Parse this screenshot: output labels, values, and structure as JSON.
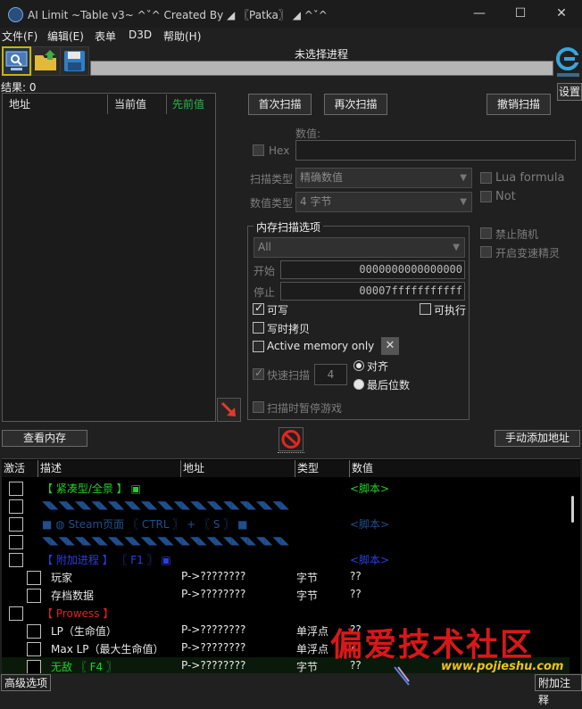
{
  "window": {
    "title": "AI Limit ~Table v3~   ^ˇ^ Created By ◢ 〖Patka〗 ◢ ^ˇ^",
    "controls": {
      "min": "—",
      "max": "☐",
      "close": "✕"
    }
  },
  "menu": [
    "文件(F)",
    "编辑(E)",
    "表单",
    "D3D",
    "帮助(H)"
  ],
  "toolbar": {
    "process_title": "未选择进程",
    "settings": "设置",
    "icons": [
      "open-process-icon",
      "open-file-icon",
      "save-icon"
    ]
  },
  "results": {
    "label": "结果: 0"
  },
  "found_list": {
    "columns": [
      "地址",
      "当前值",
      "先前值"
    ],
    "previous_color": "#2fb54a"
  },
  "scan": {
    "first_scan": "首次扫描",
    "next_scan": "再次扫描",
    "undo_scan": "撤销扫描",
    "value_label": "数值:",
    "hex_label": "Hex",
    "value": "",
    "scan_type_label": "扫描类型",
    "scan_type_value": "精确数值",
    "value_type_label": "数值类型",
    "value_type_value": "4 字节",
    "lua_formula": "Lua formula",
    "not_label": "Not"
  },
  "memory_options": {
    "title": "内存扫描选项",
    "region": "All",
    "start_label": "开始",
    "start_value": "0000000000000000",
    "stop_label": "停止",
    "stop_value": "00007fffffffffff",
    "writable": "可写",
    "executable": "可执行",
    "copy_on_write": "写时拷贝",
    "active_memory_only": "Active memory only",
    "fast_scan": "快速扫描",
    "fast_scan_value": "4",
    "alignment": "对齐",
    "last_digits": "最后位数",
    "pause_game": "扫描时暂停游戏",
    "disable_random": "禁止随机",
    "speedhack": "开启变速精灵"
  },
  "buttons": {
    "view_memory": "查看内存",
    "add_address": "手动添加地址",
    "advanced": "高级选项",
    "table_extras": "附加注释"
  },
  "address_list": {
    "headers": [
      "激活",
      "描述",
      "地址",
      "类型",
      "数值"
    ],
    "rows": [
      {
        "desc": "【 紧凑型/全景 】  ▣",
        "address": "",
        "type": "",
        "value": "<脚本>",
        "color": "#22d022",
        "indent": 0
      },
      {
        "desc": "◥◣◥◣◥◣◥◣◥◣◥◣◥◣◥◣◥◣◥◣◥◣◥◣◥◣◥◣◥◣",
        "address": "",
        "type": "",
        "value": "",
        "color": "#1f4f8f",
        "indent": 0
      },
      {
        "desc": "■  ◍ Steam页面  〖 CTRL 〗 + 〖 S 〗  ■",
        "address": "",
        "type": "",
        "value": "<脚本>",
        "color": "#1f4f8f",
        "indent": 0
      },
      {
        "desc": "◥◣◥◣◥◣◥◣◥◣◥◣◥◣◥◣◥◣◥◣◥◣◥◣◥◣◥◣◥◣",
        "address": "",
        "type": "",
        "value": "",
        "color": "#1f4f8f",
        "indent": 0
      },
      {
        "desc": "【 附加进程 】  〖 F1 〗    ▣",
        "address": "",
        "type": "",
        "value": "<脚本>",
        "color": "#2b3fe0",
        "indent": 0
      },
      {
        "desc": "玩家",
        "address": "P->????????",
        "type": "字节",
        "value": "??",
        "color": "#e8e8e8",
        "indent": 1
      },
      {
        "desc": "存档数据",
        "address": "P->????????",
        "type": "字节",
        "value": "??",
        "color": "#e8e8e8",
        "indent": 1
      },
      {
        "desc": "【 Prowess 】",
        "address": "",
        "type": "",
        "value": "",
        "color": "#e02020",
        "indent": 0
      },
      {
        "desc": "LP（生命值）",
        "address": "P->????????",
        "type": "单浮点",
        "value": "??",
        "color": "#e8e8e8",
        "indent": 1
      },
      {
        "desc": "Max LP（最大生命值）",
        "address": "P->????????",
        "type": "单浮点",
        "value": "??",
        "color": "#e8e8e8",
        "indent": 1
      },
      {
        "desc": "无敌  〖 F4 〗",
        "address": "P->????????",
        "type": "字节",
        "value": "??",
        "color": "#22d022",
        "indent": 1
      }
    ]
  },
  "watermark": {
    "text": "偏爱技术社区",
    "url": "www.pojieshu.com"
  }
}
